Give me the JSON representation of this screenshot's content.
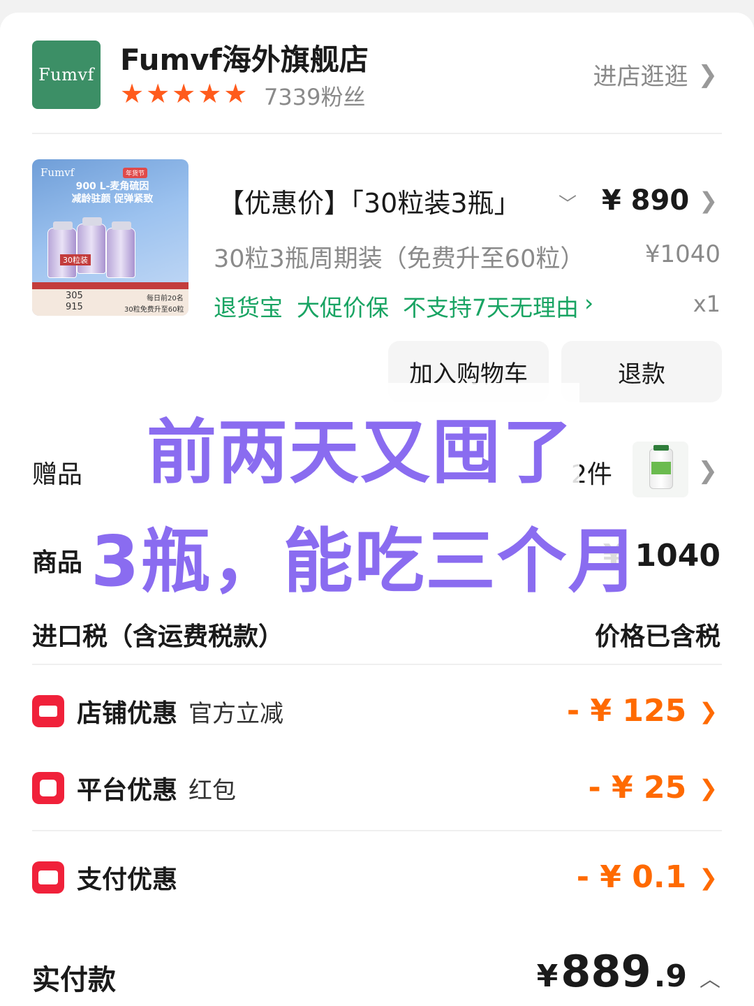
{
  "store": {
    "logo_text": "Fumvf",
    "name": "Fumvf海外旗舰店",
    "rating_stars": 5,
    "followers": "7339粉丝",
    "enter_label": "进店逛逛"
  },
  "product": {
    "thumb": {
      "brand": "Fumvf",
      "promo_tag": "年货节",
      "headline": "900 L-麦角硫因",
      "subline": "减龄驻颜 促弹紧致",
      "bottle_label": "30粒装",
      "footer_left": "305",
      "footer_left2": "915",
      "footer_right": "每日前20名",
      "footer_right2": "30粒免费升至60粒"
    },
    "sku_title": "【优惠价】「30粒装3瓶」",
    "price": "¥ 890",
    "sku_sub": "30粒3瓶周期装（免费升至60粒）",
    "original_price": "¥1040",
    "badges": [
      "退货宝",
      "大促价保",
      "不支持7天无理由"
    ],
    "quantity": "x1"
  },
  "actions": {
    "add_to_cart": "加入购物车",
    "refund": "退款"
  },
  "overlay": {
    "line1": "前两天又囤了",
    "line2": "3瓶，能吃三个月"
  },
  "gift": {
    "label": "赠品",
    "count": "2件"
  },
  "goods": {
    "label": "商品",
    "total": "¥ 1040"
  },
  "tax": {
    "label": "进口税（含运费税款）",
    "value": "价格已含税"
  },
  "discounts": [
    {
      "title": "店铺优惠",
      "sub": "官方立减",
      "amount": "- ¥ 125",
      "icon": "store-coupon-icon"
    },
    {
      "title": "平台优惠",
      "sub": "红包",
      "amount": "- ¥ 25",
      "icon": "red-packet-icon"
    },
    {
      "title": "支付优惠",
      "sub": "",
      "amount": "- ¥ 0.1",
      "icon": "card-icon"
    }
  ],
  "payment": {
    "label": "实付款",
    "currency": "¥",
    "integer": "889",
    "decimal": ".9"
  },
  "colors": {
    "accent_green": "#19a463",
    "discount_orange": "#ff6a00",
    "icon_red": "#f0213a",
    "star_orange": "#ff5b1c",
    "overlay_purple": "#8a6cf0",
    "logo_green": "#3c8f66"
  }
}
